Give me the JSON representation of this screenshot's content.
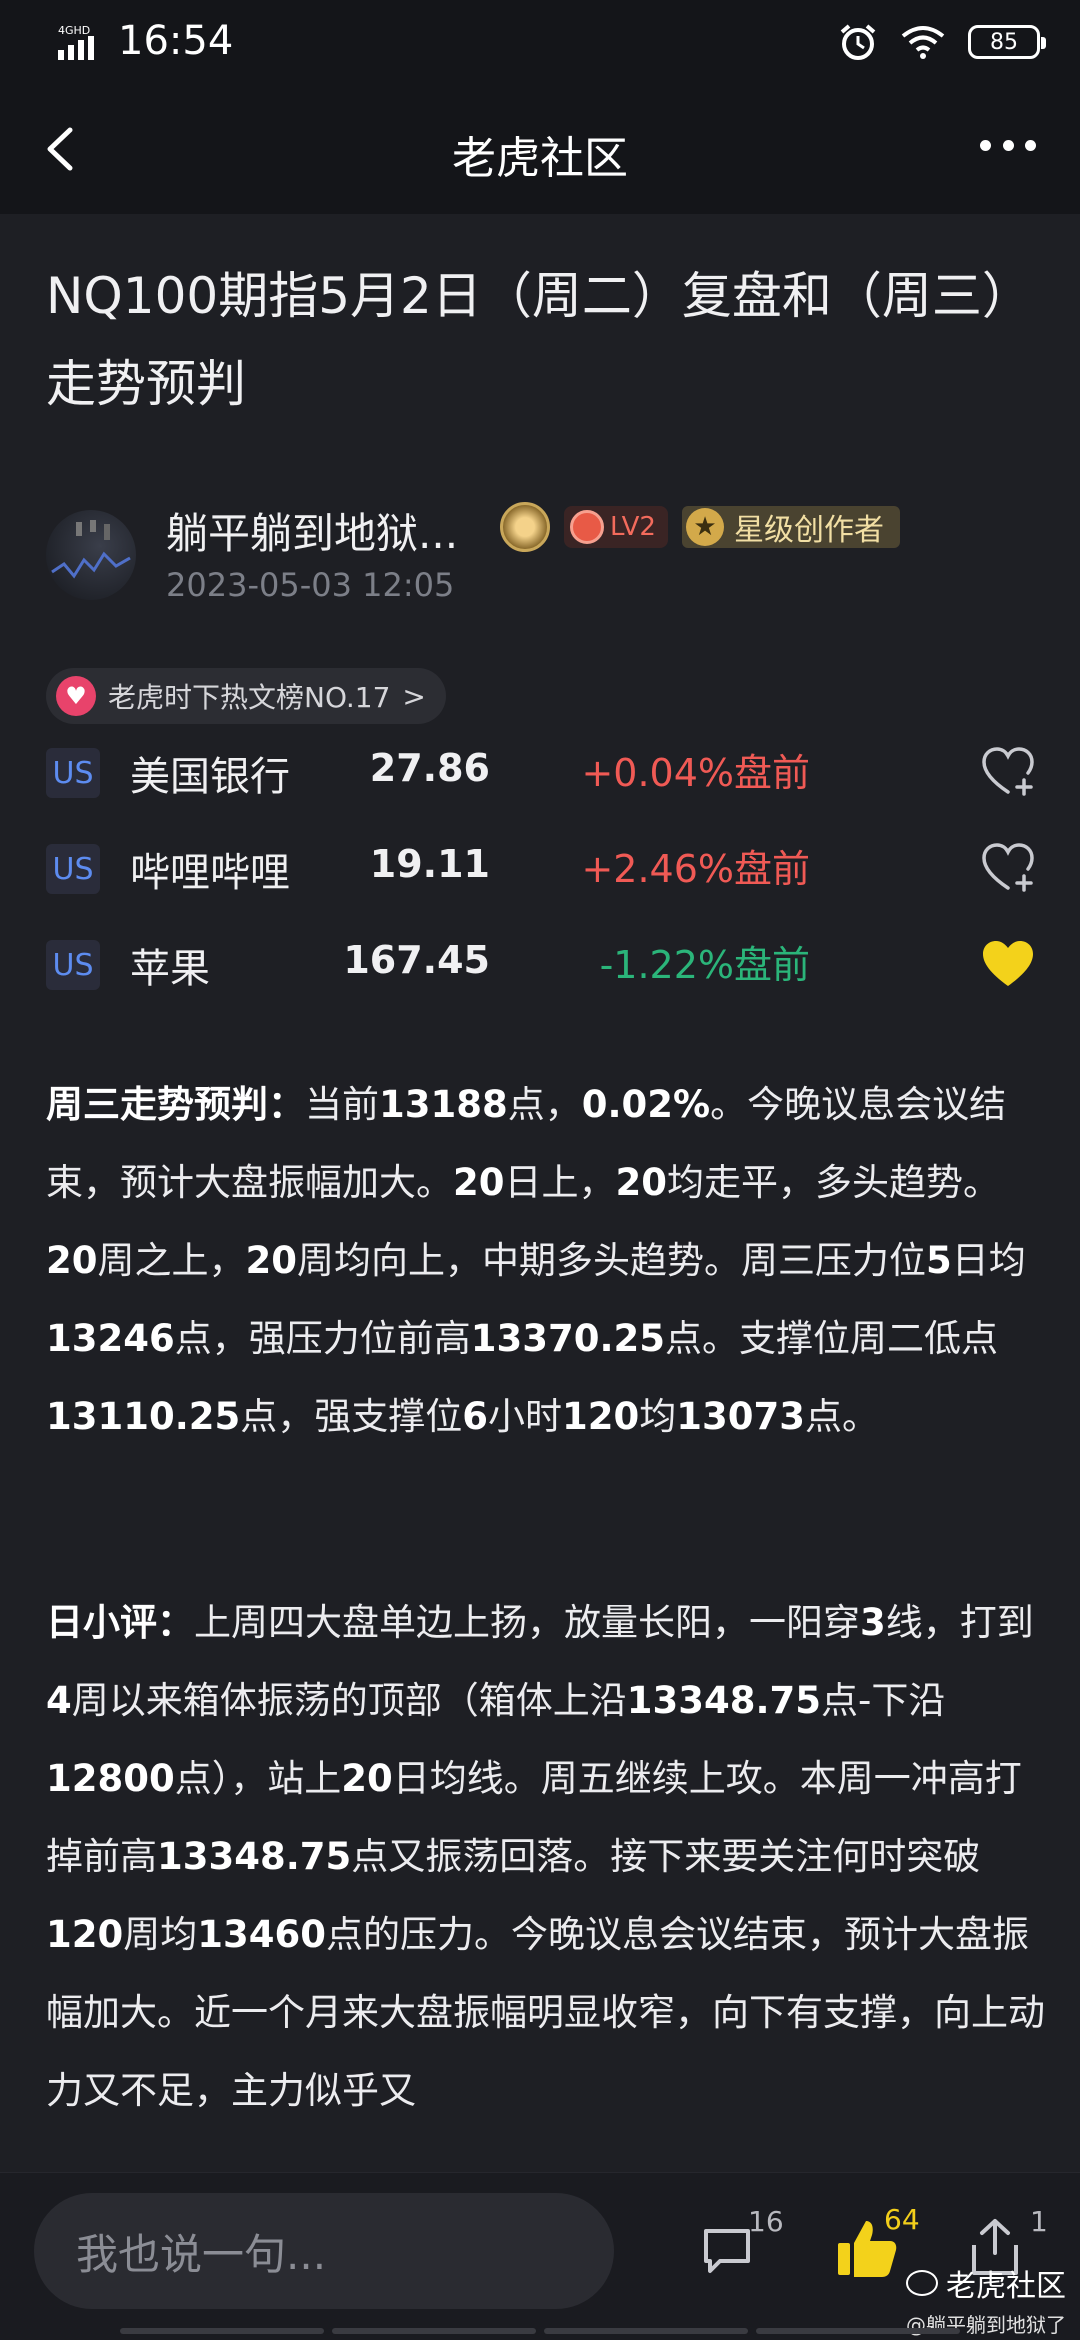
{
  "status": {
    "network": "4GHD",
    "time": "16:54",
    "battery": "85"
  },
  "nav": {
    "title": "老虎社区"
  },
  "article": {
    "title": "NQ100期指5月2日（周二）复盘和（周三）走势预判"
  },
  "author": {
    "name": "躺平躺到地狱...",
    "level": "LV2",
    "star_badge": "星级创作者",
    "date": "2023-05-03 12:05"
  },
  "hot_tag": {
    "label": "老虎时下热文榜NO.17",
    "chevron": ">"
  },
  "stocks": [
    {
      "market": "US",
      "name": "美国银行",
      "price": "27.86",
      "change": "+0.04%盘前",
      "direction": "up",
      "watched": false
    },
    {
      "market": "US",
      "name": "哔哩哔哩",
      "price": "19.11",
      "change": "+2.46%盘前",
      "direction": "up",
      "watched": false
    },
    {
      "market": "US",
      "name": "苹果",
      "price": "167.45",
      "change": "-1.22%盘前",
      "direction": "down",
      "watched": true
    }
  ],
  "paragraphs": {
    "p1_head": "周三走势预判：",
    "p1_body_a": "当前",
    "p1_bold_a": "13188",
    "p1_body_b": "点，",
    "p1_bold_b": "0.02%",
    "p1_body_c": "。今晚议息会议结束，预计大盘振幅加大。",
    "p1_bold_c": "20",
    "p1_body_d": "日上，",
    "p1_bold_d": "20",
    "p1_body_e": "均走平，多头趋势。",
    "p1_bold_e": "20",
    "p1_body_f": "周之上，",
    "p1_bold_f": "20",
    "p1_body_g": "周均向上，中期多头趋势。周三压力位",
    "p1_bold_g": "5",
    "p1_body_h": "日均",
    "p1_bold_h": "13246",
    "p1_body_i": "点，强压力位前高",
    "p1_bold_i": "13370.25",
    "p1_body_j": "点。支撑位周二低点",
    "p1_bold_j": "13110.25",
    "p1_body_k": "点，强支撑位",
    "p1_bold_k": "6",
    "p1_body_l": "小时",
    "p1_bold_l": "120",
    "p1_body_m": "均",
    "p1_bold_m": "13073",
    "p1_body_n": "点。",
    "p2_head": "日小评：",
    "p2_body_a": "上周四大盘单边上扬，放量长阳，一阳穿",
    "p2_bold_a": "3",
    "p2_body_b": "线，打到",
    "p2_bold_b": "4",
    "p2_body_c": "周以来箱体振荡的顶部（箱体上沿",
    "p2_bold_c": "13348.75",
    "p2_body_d": "点-下沿",
    "p2_bold_d": "12800",
    "p2_body_e": "点），站上",
    "p2_bold_e": "20",
    "p2_body_f": "日均线。周五继续上攻。本周一冲高打掉前高",
    "p2_bold_f": "13348.75",
    "p2_body_g": "点又振荡回落。接下来要关注何时突破",
    "p2_bold_g": "120",
    "p2_body_h": "周均",
    "p2_bold_h": "13460",
    "p2_body_i": "点的压力。今晚议息会议结束，预计大盘振幅加大。近一个月来大盘振幅明显收窄，向下有支撑，向上动力又不足，主力似乎又"
  },
  "bottom": {
    "input_placeholder": "我也说一句...",
    "comment_count": "16",
    "like_count": "64",
    "share_count": "1",
    "watermark": "老虎社区",
    "watermark_sub": "@躺平躺到地狱了"
  },
  "colors": {
    "up": "#f05a55",
    "down": "#2bb57a",
    "watched": "#f3d21b",
    "accent_blue": "#5d8cf0"
  }
}
